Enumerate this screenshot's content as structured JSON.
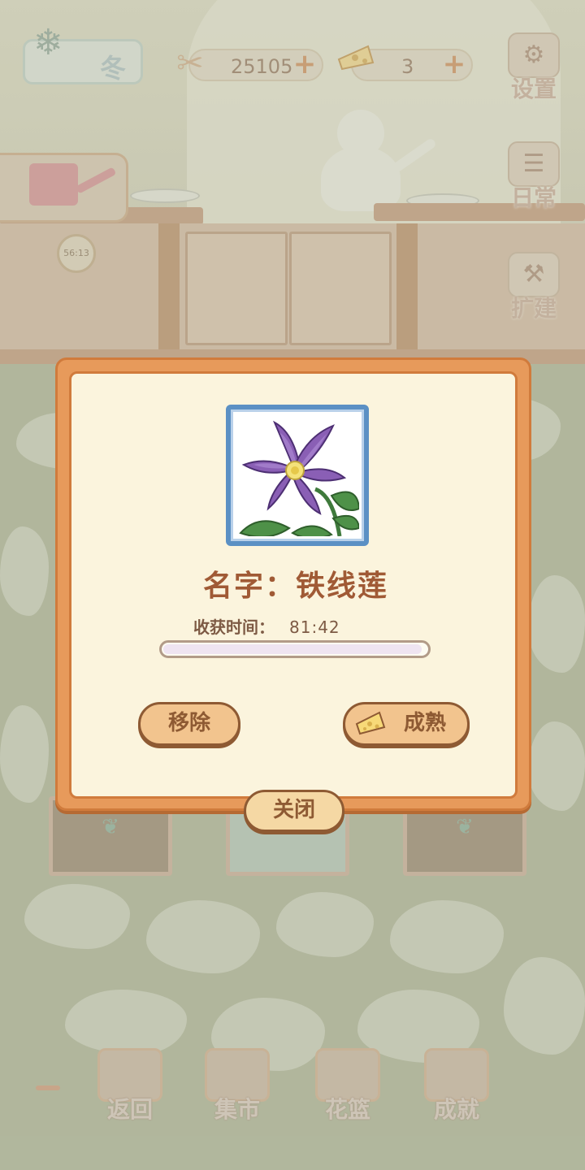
{
  "hud": {
    "season_label": "冬",
    "fish_count": "25105",
    "cheese_count": "3",
    "plus_symbol": "+"
  },
  "side_buttons": [
    {
      "label": "设置",
      "icon": "gear-icon"
    },
    {
      "label": "日常",
      "icon": "checklist-icon"
    },
    {
      "label": "扩建",
      "icon": "hammer-icon"
    }
  ],
  "clock_text": "56:13",
  "dialog": {
    "plant_name": "名字：铁线莲",
    "harvest_label": "收获时间：",
    "harvest_time": "81:42",
    "progress_fraction": 0.02,
    "remove_label": "移除",
    "ripen_label": "成熟",
    "close_label": "关闭"
  },
  "bottom_nav": [
    {
      "label": "返回",
      "icon": "window-icon"
    },
    {
      "label": "集市",
      "icon": "market-stall-icon"
    },
    {
      "label": "花篮",
      "icon": "flower-basket-icon"
    },
    {
      "label": "成就",
      "icon": "trophy-icon"
    }
  ],
  "colors": {
    "dialog_border": "#e79a5b",
    "dialog_bg": "#fbf4dd",
    "text_brown": "#a05a35",
    "button_fill": "#f2c48e",
    "frame_blue": "#5b90c4"
  }
}
